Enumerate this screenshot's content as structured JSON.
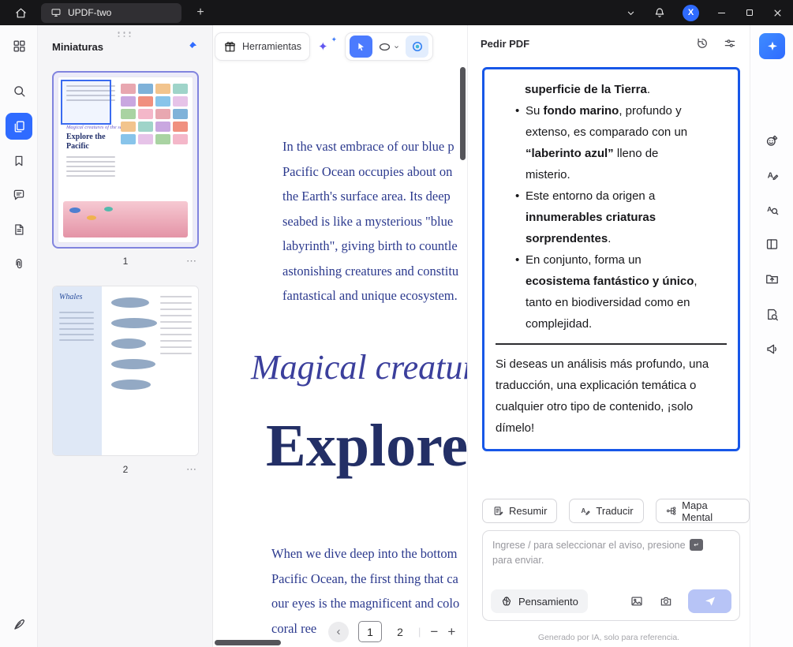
{
  "titlebar": {
    "tab_title": "UPDF-two",
    "add_tab_glyph": "+",
    "avatar_letter": "X"
  },
  "left_rail": {
    "items": [
      "apps-grid",
      "search",
      "page-thumbnails",
      "bookmarks",
      "comments",
      "pages",
      "attachments",
      "signature-pen"
    ]
  },
  "right_rail": {
    "items": [
      "ai-assistant",
      "emoji-annotation",
      "text-edit",
      "text-recognition",
      "page-layout",
      "export-file",
      "document-search",
      "share-feedback"
    ]
  },
  "thumbnails_panel": {
    "title": "Miniaturas",
    "pages": [
      {
        "label": "1",
        "more_glyph": "⋯",
        "preview_subtitle": "Magical creatures of the sea.",
        "preview_title": "Explore the Pacific"
      },
      {
        "label": "2",
        "more_glyph": "⋯",
        "preview_title": "Whales"
      }
    ]
  },
  "doc_toolbar": {
    "tools_label": "Herramientas",
    "sparkle_large_glyph": "✦",
    "sparkle_small_glyph": "✦"
  },
  "document": {
    "paragraph1_lines": [
      "In the vast embrace of our blue p",
      "Pacific Ocean occupies about on",
      "the Earth's surface area. Its deep",
      "seabed is like a mysterious \"blue",
      "labyrinth\", giving birth to countle",
      "astonishing creatures and constitu",
      "fantastical and unique ecosystem."
    ],
    "heading_italic": "Magical creatures",
    "heading_main": "Explore",
    "paragraph2_lines": [
      "When we dive deep into the bottom",
      "Pacific Ocean, the first thing that ca",
      "our eyes is the magnificent and colo",
      "coral ree"
    ],
    "page_nav": {
      "prev_glyph": "‹",
      "current_page": "1",
      "next_page_label": "2",
      "divider_glyph": "|",
      "zoom_out_glyph": "−",
      "zoom_in_glyph": "+"
    }
  },
  "ai_panel": {
    "title": "Pedir PDF",
    "response": {
      "bullet_glyph": "•",
      "partial_line": {
        "segments": [
          {
            "text": "superficie de la Tierra",
            "bold": true
          },
          {
            "text": "."
          }
        ]
      },
      "bullets": [
        {
          "segments": [
            {
              "text": "Su "
            },
            {
              "text": "fondo marino",
              "bold": true
            },
            {
              "text": ", profundo y extenso, es comparado con un "
            },
            {
              "text": "“laberinto azul”",
              "bold": true
            },
            {
              "text": " lleno de misterio."
            }
          ]
        },
        {
          "segments": [
            {
              "text": "Este entorno da origen a "
            },
            {
              "text": "innumerables criaturas sorprendentes",
              "bold": true
            },
            {
              "text": "."
            }
          ]
        },
        {
          "segments": [
            {
              "text": "En conjunto, forma un "
            },
            {
              "text": "ecosistema fantástico y único",
              "bold": true
            },
            {
              "text": ", tanto en biodiversidad como en complejidad."
            }
          ]
        }
      ],
      "closing": "Si deseas un análisis más profundo, una traducción, una explicación temática o cualquier otro tipo de contenido, ¡solo dímelo!",
      "more_glyph": "⋯",
      "divider_glyph": "|"
    },
    "quick_actions": [
      {
        "label": "Resumir"
      },
      {
        "label": "Traducir"
      },
      {
        "label": "Mapa Mental"
      }
    ],
    "input": {
      "placeholder_prefix": "Ingrese / para seleccionar el aviso, presione",
      "placeholder_suffix": "para enviar.",
      "thinking_label": "Pensamiento"
    },
    "footer": "Generado por IA, solo para referencia."
  },
  "colors": {
    "accent_blue": "#2f6bff",
    "response_border": "#1757e8",
    "document_text": "#2c3a8e",
    "heading_text": "#232f66",
    "heading_italic_text": "#3b3f9c",
    "send_button": "#b7c4f6",
    "selected_thumbnail_border": "#8184de"
  }
}
